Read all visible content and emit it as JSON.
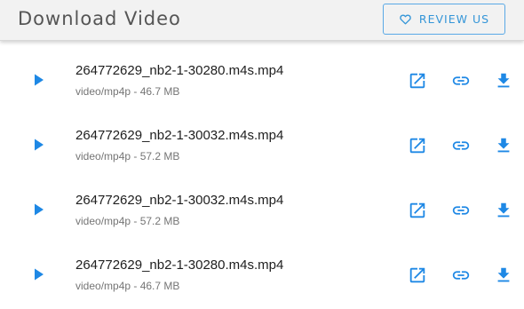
{
  "header": {
    "title": "Download Video",
    "review_label": "REVIEW US",
    "review_icon": "heart-outline-icon"
  },
  "colors": {
    "accent": "#1e88e5",
    "header_bg": "#f2f2f2",
    "title_text": "#555555",
    "meta_text": "#757575"
  },
  "files": [
    {
      "name": "264772629_nb2-1-30280.m4s.mp4",
      "meta": "video/mp4p - 46.7 MB"
    },
    {
      "name": "264772629_nb2-1-30032.m4s.mp4",
      "meta": "video/mp4p - 57.2 MB"
    },
    {
      "name": "264772629_nb2-1-30032.m4s.mp4",
      "meta": "video/mp4p - 57.2 MB"
    },
    {
      "name": "264772629_nb2-1-30280.m4s.mp4",
      "meta": "video/mp4p - 46.7 MB"
    }
  ],
  "row_icons": {
    "play": "play-icon",
    "open": "open-in-new-icon",
    "link": "link-icon",
    "download": "download-icon"
  }
}
